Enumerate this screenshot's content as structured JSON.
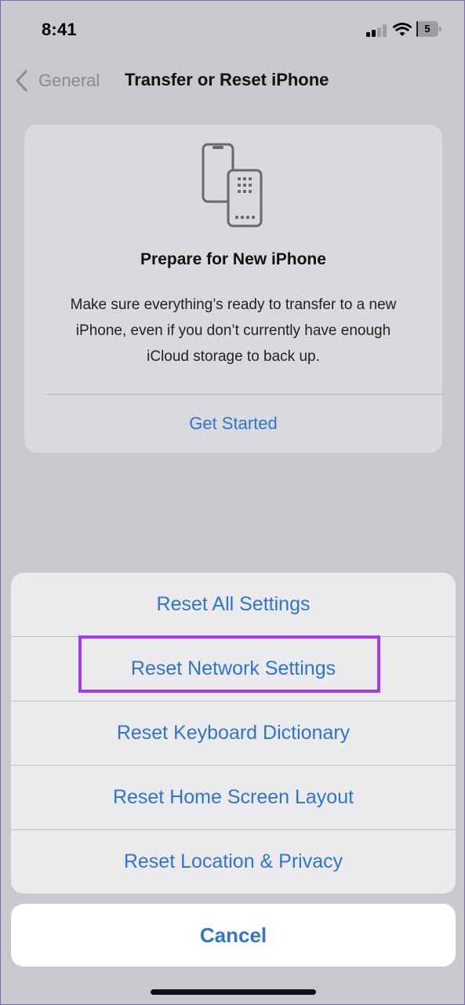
{
  "status_bar": {
    "time": "8:41",
    "battery_text": "5",
    "battery_level": 0.05,
    "signal_bars": 2
  },
  "nav": {
    "back_label": "General",
    "title": "Transfer or Reset iPhone"
  },
  "prepare_card": {
    "title": "Prepare for New iPhone",
    "description": "Make sure everything’s ready to transfer to a new iPhone, even if you don’t currently have enough iCloud storage to back up.",
    "action_label": "Get Started"
  },
  "action_sheet": {
    "items": [
      {
        "label": "Reset All Settings"
      },
      {
        "label": "Reset Network Settings"
      },
      {
        "label": "Reset Keyboard Dictionary"
      },
      {
        "label": "Reset Home Screen Layout"
      },
      {
        "label": "Reset Location & Privacy"
      }
    ],
    "highlighted_index": 1,
    "cancel_label": "Cancel"
  },
  "colors": {
    "accent_blue": "#2f74cf",
    "highlight_purple": "#a33be8",
    "background_gray": "#c9c8cc",
    "sheet_gray": "#ebebee"
  },
  "icons": {
    "back": "chevron-left-icon",
    "signal": "cellular-signal-icon",
    "wifi": "wifi-icon",
    "battery": "battery-icon",
    "card": "transfer-phones-icon"
  }
}
